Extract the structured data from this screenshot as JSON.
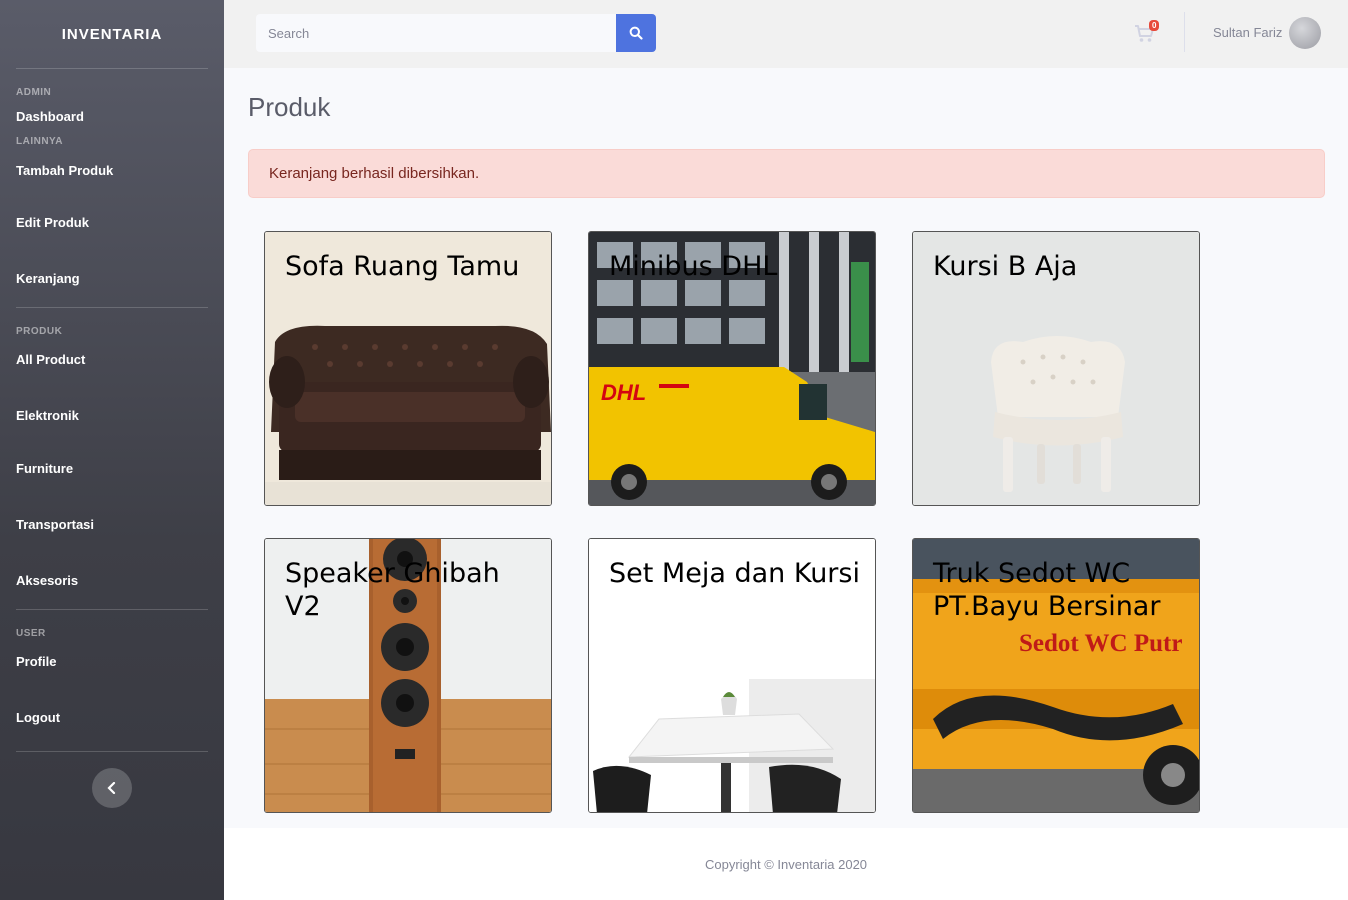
{
  "sidebar": {
    "brand": "INVENTARIA",
    "sections": [
      {
        "heading": "ADMIN",
        "items": [
          "Dashboard"
        ]
      },
      {
        "heading": "LAINNYA",
        "items": [
          "Tambah Produk",
          "Edit Produk",
          "Keranjang"
        ]
      },
      {
        "heading": "PRODUK",
        "items": [
          "All Product",
          "Elektronik",
          "Furniture",
          "Transportasi",
          "Aksesoris"
        ]
      },
      {
        "heading": "USER",
        "items": [
          "Profile",
          "Logout"
        ]
      }
    ]
  },
  "topbar": {
    "search_placeholder": "Search",
    "cart_count": "0",
    "username": "Sultan Fariz"
  },
  "main": {
    "title": "Produk",
    "alert": "Keranjang berhasil dibersihkan.",
    "products": [
      {
        "title": "Sofa Ruang Tamu"
      },
      {
        "title": "Minibus DHL"
      },
      {
        "title": "Kursi B Aja"
      },
      {
        "title": "Speaker Ghibah V2"
      },
      {
        "title": "Set Meja dan Kursi"
      },
      {
        "title": "Truk Sedot WC PT.Bayu Bersinar"
      }
    ],
    "truck_text": "Sedot WC Putr"
  },
  "footer": {
    "copyright": "Copyright © Inventaria 2020"
  },
  "colors": {
    "primary": "#4e73df",
    "alert_bg": "#fadbd8",
    "badge": "#e74a3b"
  }
}
